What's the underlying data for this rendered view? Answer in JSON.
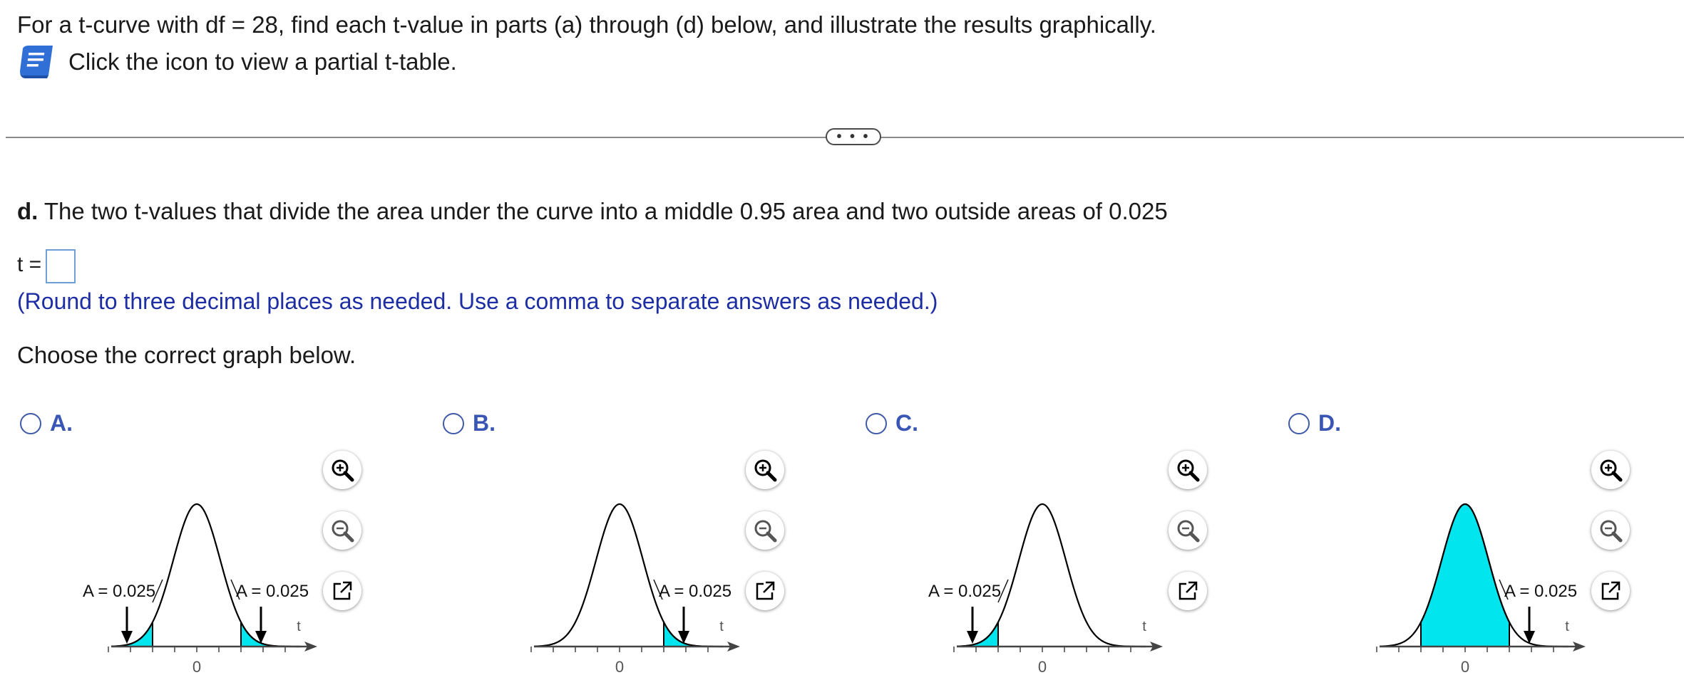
{
  "question": {
    "intro": "For a t-curve with df = 28, find each t-value in parts (a) through (d) below, and illustrate the results graphically.",
    "table_link": "Click the icon to view a partial t-table.",
    "book_icon": "book-icon"
  },
  "expand_label": "• • •",
  "part_d": {
    "letter": "d.",
    "text": " The two t-values that divide the area under the curve into a middle 0.95 area and two outside areas of 0.025",
    "answer_prefix": "t =",
    "answer_value": "",
    "note": "(Round to three decimal places as needed. Use a comma to separate answers as needed.)",
    "choose": "Choose the correct graph below."
  },
  "colors": {
    "shade": "#00e5ee",
    "accent": "#3a56b5",
    "note": "#1d2ea5"
  },
  "options": [
    {
      "label": "A.",
      "shading": "both-tails",
      "area_labels": [
        "A = 0.025",
        "A = 0.025"
      ],
      "axis_var": "t",
      "axis_zero": "0"
    },
    {
      "label": "B.",
      "shading": "right-tail",
      "area_labels": [
        "",
        "A = 0.025"
      ],
      "axis_var": "t",
      "axis_zero": "0"
    },
    {
      "label": "C.",
      "shading": "left-tail",
      "area_labels": [
        "A = 0.025",
        ""
      ],
      "axis_var": "t",
      "axis_zero": "0"
    },
    {
      "label": "D.",
      "shading": "middle",
      "area_labels": [
        "",
        "A = 0.025"
      ],
      "axis_var": "t",
      "axis_zero": "0"
    }
  ],
  "tool_icons": [
    "zoom-in-icon",
    "zoom-out-icon",
    "external-link-icon"
  ]
}
